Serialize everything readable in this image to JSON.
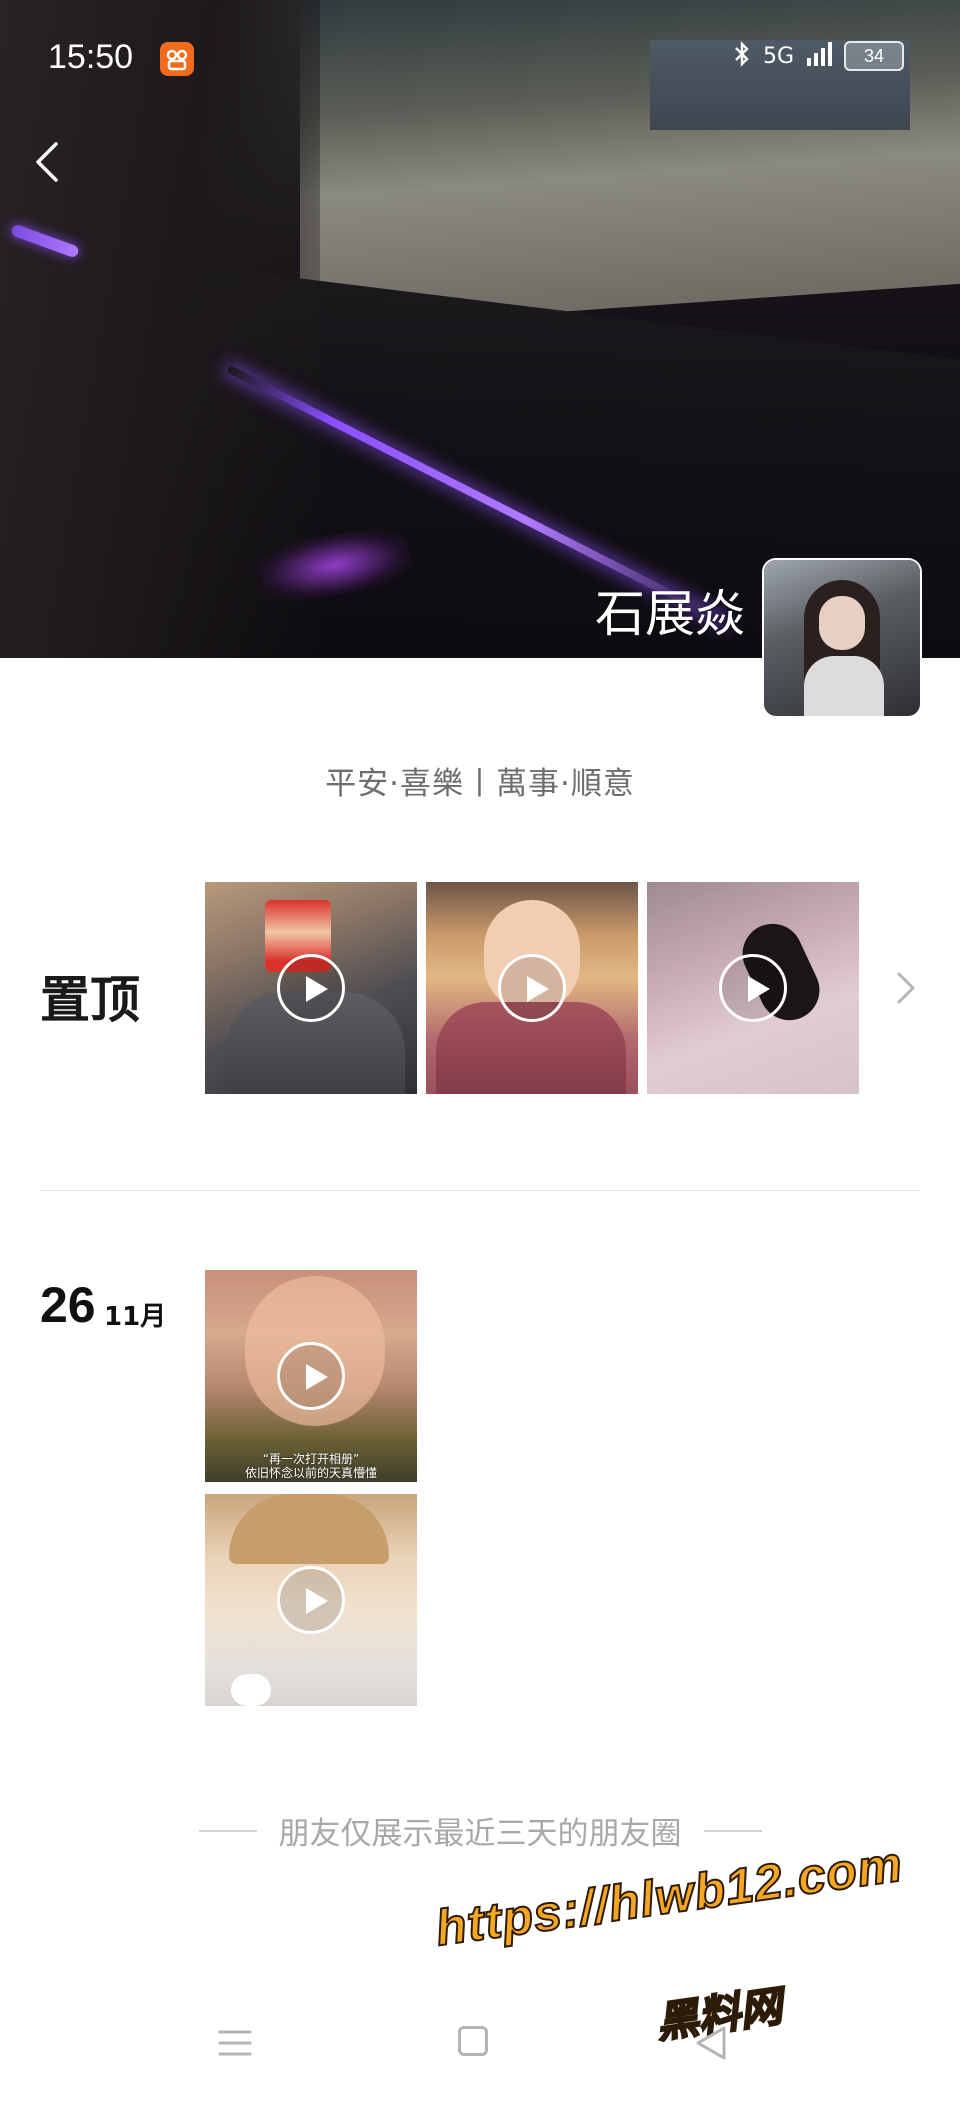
{
  "status_bar": {
    "time": "15:50",
    "network": "5G",
    "battery": "34",
    "icons": [
      "app-icon",
      "bluetooth-icon",
      "signal-icon",
      "battery-icon"
    ]
  },
  "profile": {
    "name": "石展焱",
    "signature": "平安·喜樂丨萬事·順意"
  },
  "pinned": {
    "label": "置顶",
    "count": 3
  },
  "posts": {
    "day": "26",
    "month": "11月",
    "video_caption_line1": "“再一次打开相册”",
    "video_caption_line2": "依旧怀念以前的天真懵懂"
  },
  "footer_note": "朋友仅展示最近三天的朋友圈",
  "watermark": {
    "url": "https://hlwb12.com",
    "name": "黑料网"
  },
  "colors": {
    "watermark": "#f5a623",
    "cover_accent": "#8a4dff"
  }
}
